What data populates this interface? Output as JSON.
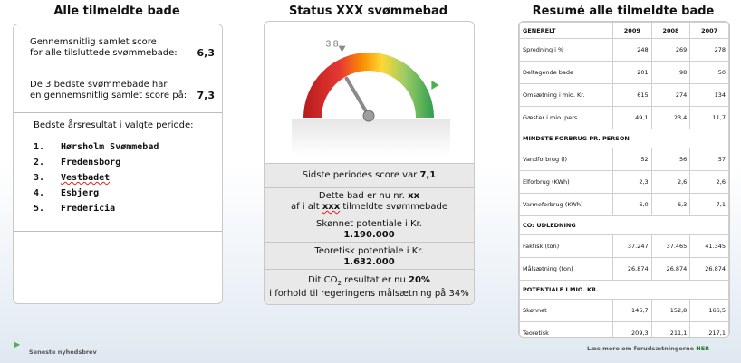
{
  "titles": {
    "left": "Alle tilmeldte bade",
    "mid": "Status XXX svømmebad",
    "right": "Resumé alle tilmeldte bade"
  },
  "left": {
    "avg_line1": "Gennemsnitlig samlet score",
    "avg_line2": "for alle tilsluttede svømmebade:",
    "avg_value": "6,3",
    "top3_line1": "De 3 bedste svømmebade har",
    "top3_line2": "en gennemsnitlig samlet score på:",
    "top3_value": "7,3",
    "best_heading": "Bedste årsresultat i valgte periode:",
    "best": [
      {
        "rank": "1.",
        "name": "Hørsholm Svømmebad"
      },
      {
        "rank": "2.",
        "name": "Fredensborg"
      },
      {
        "rank": "3.",
        "name": "Vestbadet"
      },
      {
        "rank": "4.",
        "name": "Esbjerg"
      },
      {
        "rank": "5.",
        "name": "Fredericia"
      }
    ]
  },
  "mid": {
    "gauge": {
      "score": 7.1,
      "min": 0,
      "max": 10,
      "marker_label": "3,8",
      "marker_value": 3.8
    },
    "last_score_text": "Sidste periodes score var",
    "last_score": "7,1",
    "rank_line1_a": "Dette bad er nu nr.",
    "rank_line1_b": "xx",
    "rank_line2_a": "af i alt",
    "rank_line2_b": "xxx",
    "rank_line2_c": "tilmeldte svømmebade",
    "est_label": "Skønnet potentiale i Kr.",
    "est_value": "1.190.000",
    "theo_label": "Teoretisk potentiale i Kr.",
    "theo_value": "1.632.000",
    "co2_line1_a": "Dit CO",
    "co2_line1_sub": "2",
    "co2_line1_b": " resultat er nu",
    "co2_line1_c": "20%",
    "co2_line2": "i forhold til regeringens målsætning på 34%"
  },
  "right": {
    "header": [
      "GENERELT",
      "2009",
      "2008",
      "2007"
    ],
    "groups": [
      {
        "rows": [
          [
            "Spredning i %",
            "248",
            "269",
            "278"
          ],
          [
            "Deltagende bade",
            "201",
            "98",
            "50"
          ],
          [
            "Omsætning i mio. Kr.",
            "615",
            "274",
            "134"
          ],
          [
            "Gæster i mio. pers",
            "49,1",
            "23,4",
            "11,7"
          ]
        ]
      },
      {
        "title": "MINDSTE FORBRUG PR. PERSON",
        "rows": [
          [
            "Vandforbrug (l)",
            "52",
            "56",
            "57"
          ],
          [
            "Elforbrug (KWh)",
            "2,3",
            "2,6",
            "2,6"
          ],
          [
            "Varmeforbrug (KWh)",
            "6,0",
            "6,3",
            "7,1"
          ]
        ]
      },
      {
        "title": "CO₂ UDLEDNING",
        "rows": [
          [
            "Faktisk (ton)",
            "37.247",
            "37.465",
            "41.345"
          ],
          [
            "Målsætning (ton)",
            "26.874",
            "26.874",
            "26.874"
          ]
        ]
      },
      {
        "title": "POTENTIALE I MIO. KR.",
        "rows": [
          [
            "Skønnet",
            "146,7",
            "152,8",
            "166,5"
          ],
          [
            "Teoretisk",
            "209,3",
            "211,1",
            "217,1"
          ]
        ]
      }
    ]
  },
  "footer": {
    "newsletter": "Seneste nyhedsbrev",
    "more_text": "Læs mere om forudsætningerne",
    "more_link": "HER"
  }
}
